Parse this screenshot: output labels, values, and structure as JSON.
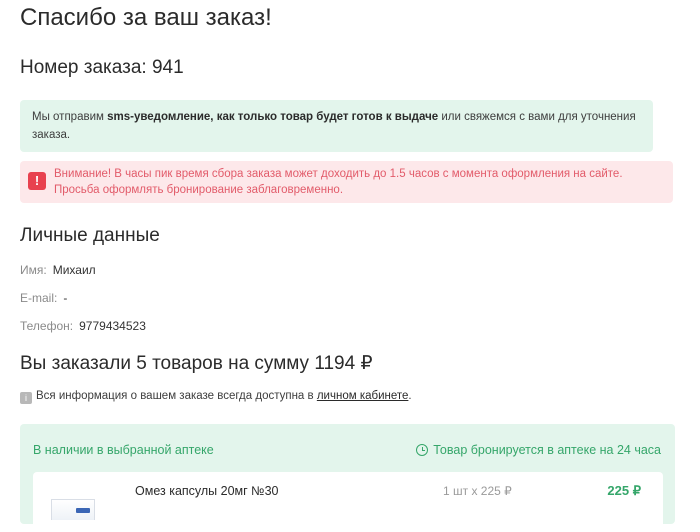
{
  "page": {
    "title": "Спасибо за ваш заказ!",
    "order_number": "Номер заказа: 941"
  },
  "notice": {
    "text_before": "Мы отправим ",
    "bold": "sms-уведомление, как только товар будет готов к выдаче",
    "text_after": " или свяжемся с вами для уточнения заказа."
  },
  "warning": {
    "icon": "!",
    "text": "Внимание! В часы пик время сбора заказа может доходить до 1.5 часов с момента оформления на сайте. Просьба оформлять бронирование заблаговременно."
  },
  "personal": {
    "title": "Личные данные",
    "name_label": "Имя:",
    "name_value": "Михаил",
    "email_label": "E-mail:",
    "email_value": "-",
    "phone_label": "Телефон:",
    "phone_value": "9779434523"
  },
  "summary": {
    "title": "Вы заказали 5 товаров на сумму 1194 ₽",
    "info_text": "Вся информация о вашем заказе всегда доступна в ",
    "info_link": "личном кабинете",
    "info_end": "."
  },
  "stock": {
    "left_label": "В наличии в выбранной аптеке",
    "right_label": "Товар бронируется в аптеке на 24 часа",
    "items": [
      {
        "name": "Омез капсулы 20мг №30",
        "qty": "1 шт х 225 ₽",
        "price": "225 ₽"
      }
    ]
  },
  "colors": {
    "accent_green": "#35a66a",
    "success_bg": "#e3f5ec",
    "warning_bg": "#fde8ea",
    "warning_text": "#e25b6a",
    "warning_icon": "#e8414f"
  }
}
